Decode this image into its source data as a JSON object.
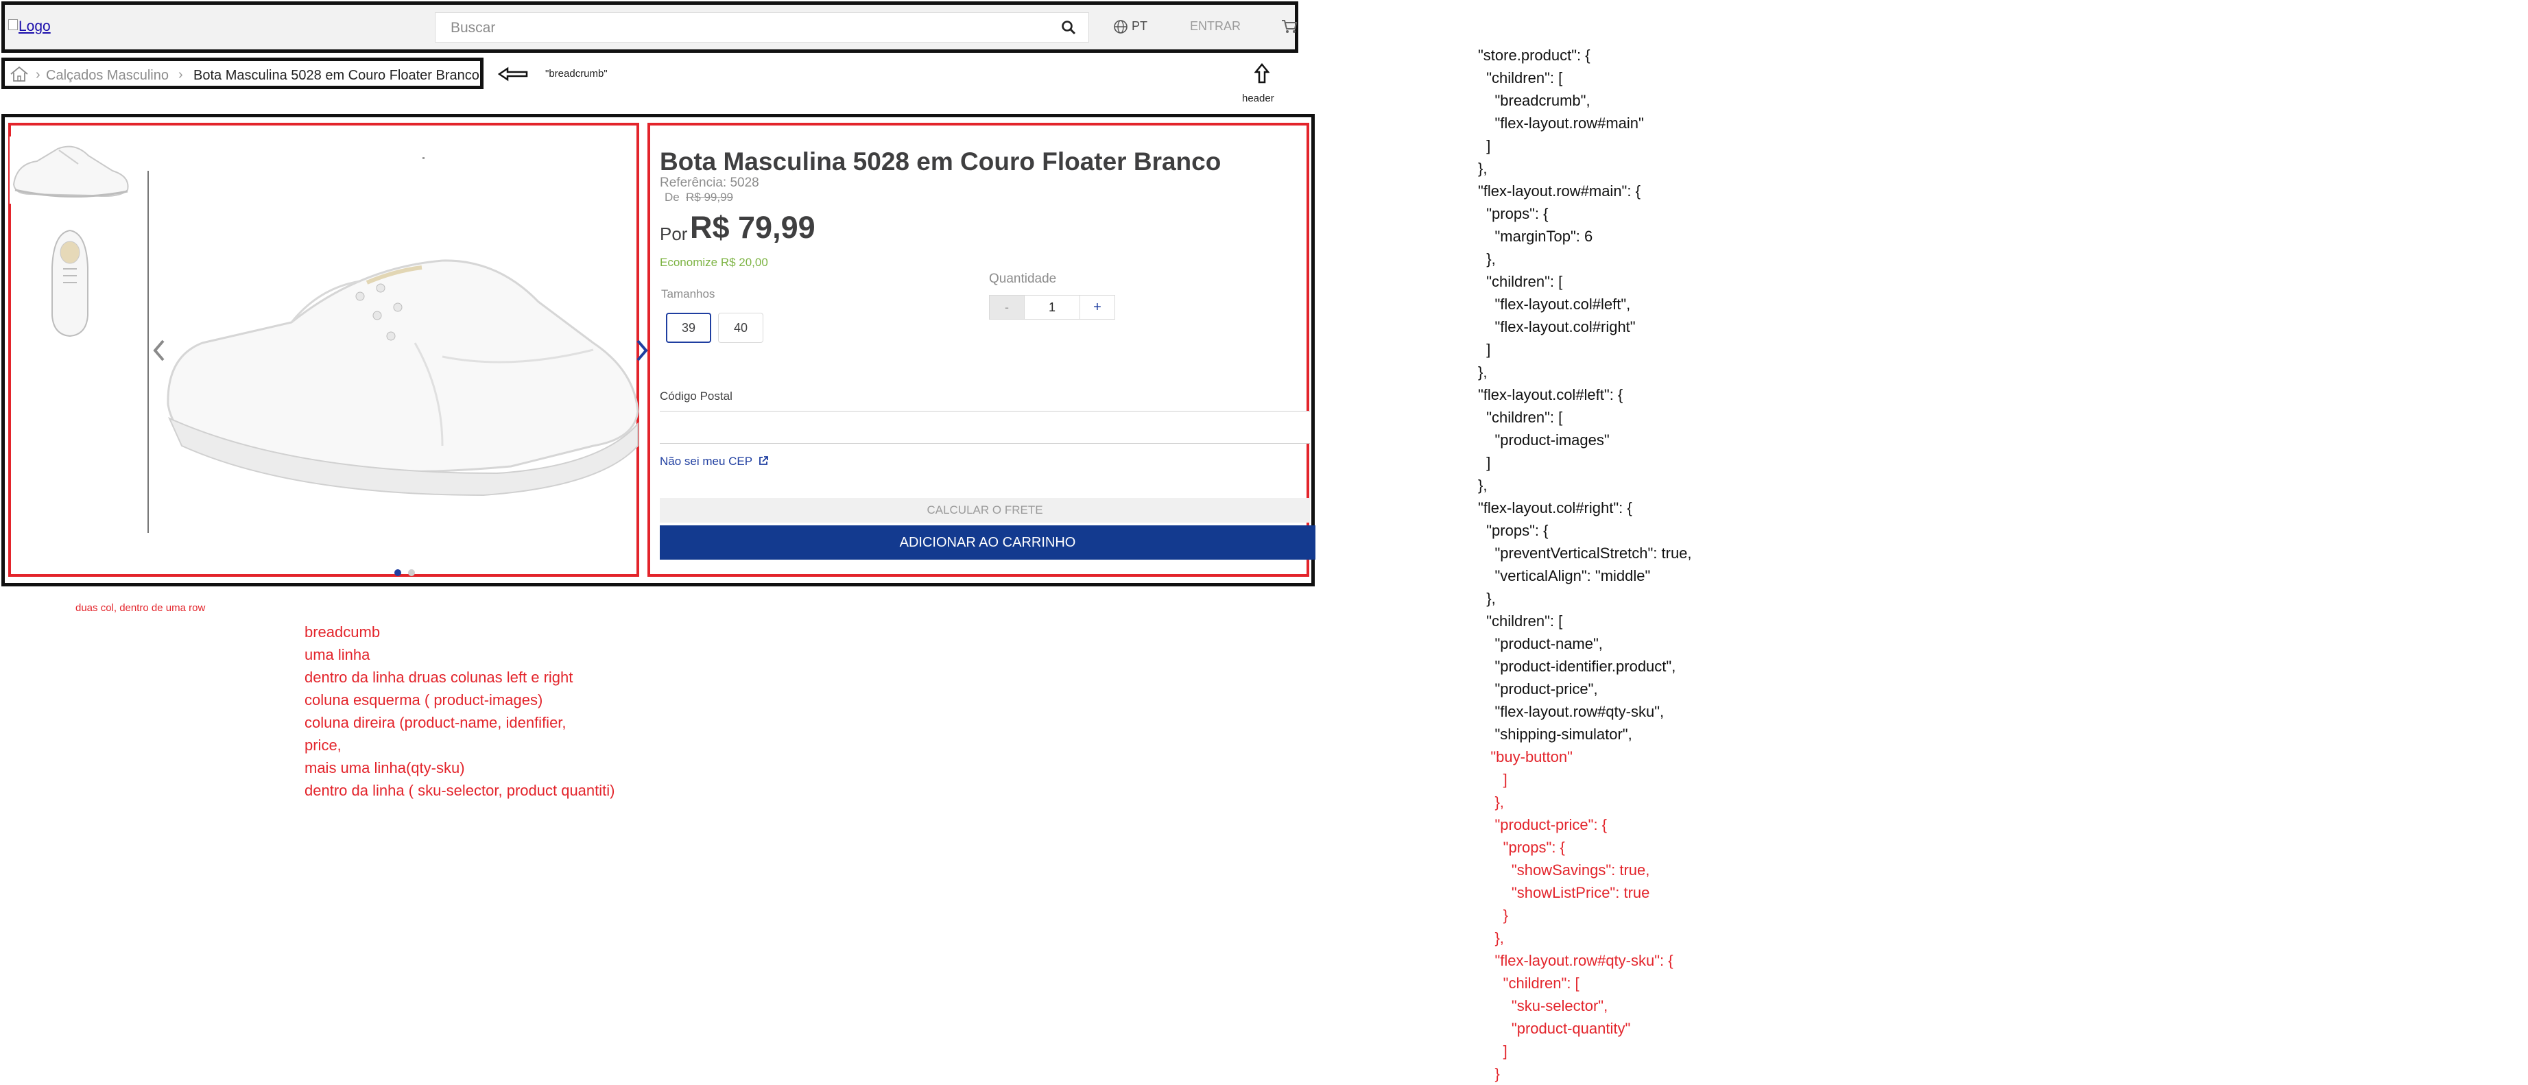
{
  "header": {
    "logo_alt": "Logo",
    "search_placeholder": "Buscar",
    "language": "PT",
    "login_label": "ENTRAR",
    "icons": [
      "search-icon",
      "globe-icon",
      "cart-icon"
    ]
  },
  "breadcrumb": {
    "items": [
      "Calçados Masculino",
      "Bota Masculina 5028 em Couro Floater Branco"
    ],
    "separator": "›",
    "note": "\"breadcrumb\"",
    "header_note": "header"
  },
  "product": {
    "name": "Bota Masculina 5028 em Couro Floater Branco",
    "reference": "Referência: 5028",
    "list_price_label": "De",
    "list_price": "R$ 99,99",
    "price_prefix": "Por",
    "price": "R$ 79,99",
    "savings": "Economize R$ 20,00",
    "sizes_label": "Tamanhos",
    "sizes": [
      "39",
      "40"
    ],
    "selected_size": "39",
    "quantity_label": "Quantidade",
    "quantity_minus": "-",
    "quantity": "1",
    "quantity_plus": "+",
    "postal_label": "Código Postal",
    "postal_link": "Não sei meu CEP",
    "calc_button": "CALCULAR O FRETE",
    "buy_button": "ADICIONAR AO CARRINHO"
  },
  "colors": {
    "accent": "#133a8f",
    "annotation": "#e3242b",
    "savings": "#7cb342"
  },
  "notes": {
    "two_cols": "duas col, dentro de uma row",
    "lines": [
      "breadcumb",
      "uma linha",
      "dentro da linha druas colunas left e right",
      "coluna esquerma ( product-images)",
      "coluna direira (product-name, idenfifier,",
      "price,",
      "mais uma linha(qty-sku)",
      "dentro da linha ( sku-selector, product quantiti)"
    ]
  },
  "code": {
    "lines": [
      {
        "text": "\"store.product\": {",
        "red": false
      },
      {
        "text": "  \"children\": [",
        "red": false
      },
      {
        "text": "    \"breadcrumb\",",
        "red": false
      },
      {
        "text": "    \"flex-layout.row#main\"",
        "red": false
      },
      {
        "text": "  ]",
        "red": false
      },
      {
        "text": "},",
        "red": false
      },
      {
        "text": "\"flex-layout.row#main\": {",
        "red": false
      },
      {
        "text": "  \"props\": {",
        "red": false
      },
      {
        "text": "    \"marginTop\": 6",
        "red": false
      },
      {
        "text": "  },",
        "red": false
      },
      {
        "text": "  \"children\": [",
        "red": false
      },
      {
        "text": "    \"flex-layout.col#left\",",
        "red": false
      },
      {
        "text": "    \"flex-layout.col#right\"",
        "red": false
      },
      {
        "text": "  ]",
        "red": false
      },
      {
        "text": "},",
        "red": false
      },
      {
        "text": "\"flex-layout.col#left\": {",
        "red": false
      },
      {
        "text": "  \"children\": [",
        "red": false
      },
      {
        "text": "    \"product-images\"",
        "red": false
      },
      {
        "text": "  ]",
        "red": false
      },
      {
        "text": "},",
        "red": false
      },
      {
        "text": "\"flex-layout.col#right\": {",
        "red": false
      },
      {
        "text": "  \"props\": {",
        "red": false
      },
      {
        "text": "    \"preventVerticalStretch\": true,",
        "red": false
      },
      {
        "text": "    \"verticalAlign\": \"middle\"",
        "red": false
      },
      {
        "text": "  },",
        "red": false
      },
      {
        "text": "  \"children\": [",
        "red": false
      },
      {
        "text": "    \"product-name\",",
        "red": false
      },
      {
        "text": "    \"product-identifier.product\",",
        "red": false
      },
      {
        "text": "    \"product-price\",",
        "red": false
      },
      {
        "text": "    \"flex-layout.row#qty-sku\",",
        "red": false
      },
      {
        "text": "    \"shipping-simulator\",",
        "red": false
      },
      {
        "text": "   \"buy-button\"",
        "red": true
      },
      {
        "text": "      ]",
        "red": true
      },
      {
        "text": "    },",
        "red": true
      },
      {
        "text": "    \"product-price\": {",
        "red": true
      },
      {
        "text": "      \"props\": {",
        "red": true
      },
      {
        "text": "        \"showSavings\": true,",
        "red": true
      },
      {
        "text": "        \"showListPrice\": true",
        "red": true
      },
      {
        "text": "      }",
        "red": true
      },
      {
        "text": "    },",
        "red": true
      },
      {
        "text": "    \"flex-layout.row#qty-sku\": {",
        "red": true
      },
      {
        "text": "      \"children\": [",
        "red": true
      },
      {
        "text": "        \"sku-selector\",",
        "red": true
      },
      {
        "text": "        \"product-quantity\"",
        "red": true
      },
      {
        "text": "      ]",
        "red": true
      },
      {
        "text": "    }",
        "red": true
      }
    ]
  }
}
